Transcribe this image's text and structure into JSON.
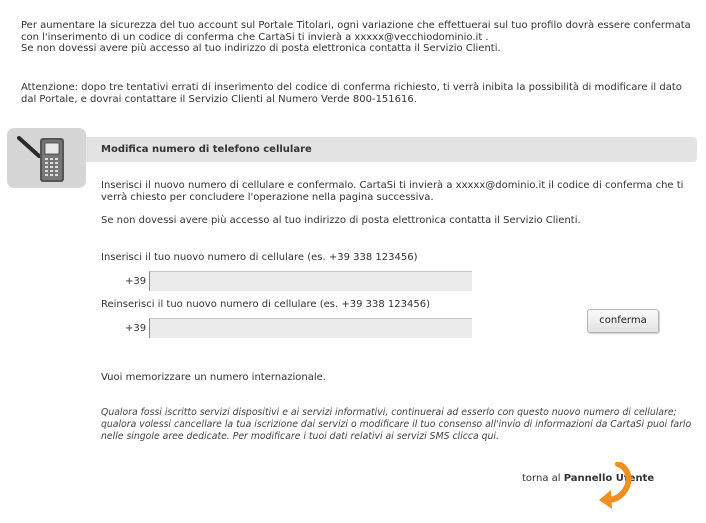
{
  "intro": {
    "line1": "Per aumentare la sicurezza del tuo account sul Portale Titolari, ogni variazione che effettuerai sul tuo profilo dovrà essere confermata con l'inserimento di un codice di conferma che CartaSi ti invierà a xxxxx@vecchiodominio.it .",
    "line2": "Se non dovessi avere più accesso al tuo indirizzo di posta elettronica contatta il Servizio Clienti."
  },
  "warning": "Attenzione: dopo tre tentativi errati di inserimento del codice di conferma richiesto, ti verrà inibita la possibilità di modificare il dato dal Portale, e dovrai contattare il Servizio Clienti al Numero Verde 800-151616.",
  "section": {
    "title": "Modifica numero di telefono cellulare",
    "icon": "mobile-phone-icon",
    "desc1": "Inserisci il nuovo numero di cellulare e confermalo. CartaSi ti invierà a xxxxx@dominio.it il codice di conferma che ti verrà chiesto per concludere l'operazione nella pagina successiva.",
    "desc2": "Se non dovessi avere più accesso al tuo indirizzo di posta elettronica contatta il Servizio Clienti."
  },
  "form": {
    "label_new": "Inserisci il tuo nuovo numero di cellulare (es. +39 338 123456)",
    "label_repeat": "Reinserisci il tuo nuovo numero di cellulare (es. +39 338 123456)",
    "prefix": "+39",
    "value_new": "",
    "value_repeat": "",
    "confirm_label": "conferma"
  },
  "international_link": "Vuoi memorizzare un numero internazionale.",
  "note": "Qualora fossi iscritto servizi dispositivi e ai servizi informativi, continuerai ad esserlo con questo nuovo numero di cellulare; qualora volessi cancellare la tua iscrizione dai servizi o modificare il tuo consenso all'invio di informazioni da CartaSi puoi farlo nelle singole aree dedicate. Per modificare i tuoi dati relativi ai servizi SMS clicca qui.",
  "back": {
    "prefix": "torna al",
    "link": "Pannello Utente",
    "icon": "curved-arrow-icon"
  },
  "colors": {
    "accent_orange": "#f0901e",
    "panel_gray": "#e3e3e3",
    "icon_box_gray": "#d6d6d6"
  }
}
